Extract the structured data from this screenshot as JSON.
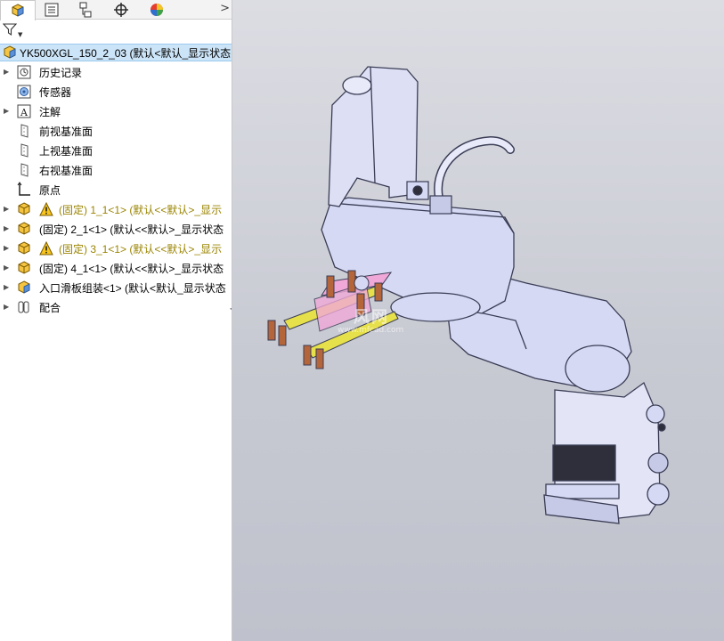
{
  "feature_tree": {
    "tabs": [
      {
        "name": "featuremanager-tab",
        "icon": "assembly-icon"
      },
      {
        "name": "propertymanager-tab",
        "icon": "property-list-icon"
      },
      {
        "name": "configurationmanager-tab",
        "icon": "configuration-icon"
      },
      {
        "name": "dimxpert-tab",
        "icon": "crosshair-icon"
      },
      {
        "name": "display-manager-tab",
        "icon": "appearance-ball-icon"
      }
    ],
    "more_glyph": ">",
    "root_label": "YK500XGL_150_2_03  (默认<默认_显示状态",
    "items": [
      {
        "label": "历史记录",
        "icon": "history-icon",
        "expander": true,
        "warning": false
      },
      {
        "label": "传感器",
        "icon": "sensor-icon",
        "expander": false,
        "warning": false
      },
      {
        "label": "注解",
        "icon": "annotation-icon",
        "expander": true,
        "warning": false
      },
      {
        "label": "前视基准面",
        "icon": "plane-icon",
        "expander": false,
        "warning": false
      },
      {
        "label": "上视基准面",
        "icon": "plane-icon",
        "expander": false,
        "warning": false
      },
      {
        "label": "右视基准面",
        "icon": "plane-icon",
        "expander": false,
        "warning": false
      },
      {
        "label": "原点",
        "icon": "origin-icon",
        "expander": false,
        "warning": false
      },
      {
        "label": "(固定) 1_1<1> (默认<<默认>_显示",
        "icon": "part-icon",
        "expander": true,
        "warning": true
      },
      {
        "label": "(固定) 2_1<1> (默认<<默认>_显示状态",
        "icon": "part-icon",
        "expander": true,
        "warning": false
      },
      {
        "label": "(固定) 3_1<1> (默认<<默认>_显示",
        "icon": "part-icon",
        "expander": true,
        "warning": true
      },
      {
        "label": "(固定) 4_1<1> (默认<<默认>_显示状态",
        "icon": "part-icon",
        "expander": true,
        "warning": false
      },
      {
        "label": "入口滑板组装<1> (默认<默认_显示状态",
        "icon": "subassembly-icon",
        "expander": true,
        "warning": false
      },
      {
        "label": "配合",
        "icon": "mates-icon",
        "expander": true,
        "warning": false
      }
    ]
  },
  "viewport": {
    "watermark_cn": "风网",
    "watermark_url": "www.mfcad.com"
  },
  "colors": {
    "selection": "#cce4f7",
    "warning_text": "#9a8400",
    "robot_body": "#d6d9f3",
    "robot_outline": "#3a3d55",
    "rail_yellow": "#e6e04a"
  }
}
